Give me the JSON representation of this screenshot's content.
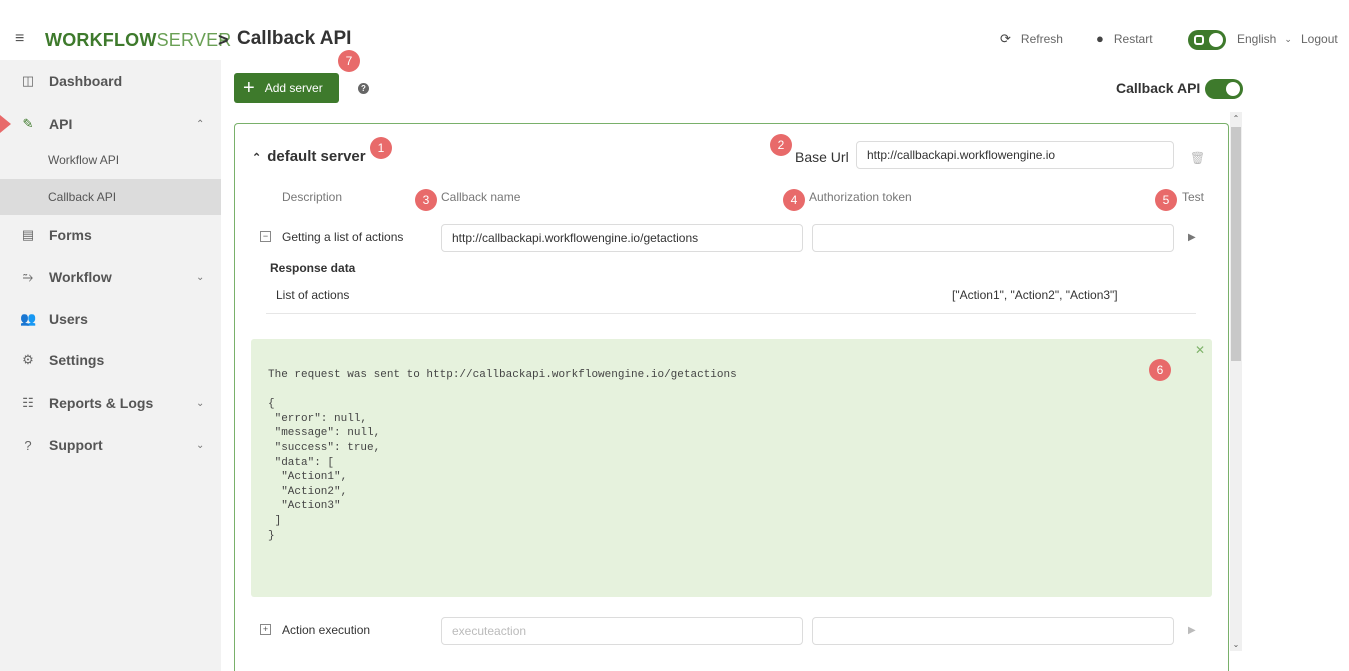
{
  "header": {
    "menu_icon": "menu-icon",
    "logo_part1": "WORKFLOW",
    "logo_part2": "SERVER",
    "separator": ">",
    "page_title": "Callback API",
    "refresh_label": "Refresh",
    "restart_label": "Restart",
    "language": "English",
    "logout_label": "Logout"
  },
  "sidebar": {
    "items": [
      {
        "label": "Dashboard",
        "icon": "dashboard-icon"
      },
      {
        "label": "API",
        "icon": "plug-icon",
        "expanded": true
      },
      {
        "label": "Workflow API"
      },
      {
        "label": "Callback API",
        "active": true
      },
      {
        "label": "Forms",
        "icon": "forms-icon"
      },
      {
        "label": "Workflow",
        "icon": "workflow-icon",
        "has_children": true
      },
      {
        "label": "Users",
        "icon": "users-icon"
      },
      {
        "label": "Settings",
        "icon": "settings-icon"
      },
      {
        "label": "Reports & Logs",
        "icon": "reports-icon",
        "has_children": true
      },
      {
        "label": "Support",
        "icon": "support-icon",
        "has_children": true
      }
    ]
  },
  "toolbar": {
    "add_server_label": "Add server",
    "help_glyph": "?",
    "callback_api_label": "Callback API",
    "callback_api_enabled": true
  },
  "server": {
    "title": "default server",
    "base_url_label": "Base Url",
    "base_url_value": "http://callbackapi.workflowengine.io",
    "columns": {
      "description": "Description",
      "callback_name": "Callback name",
      "auth_token": "Authorization token",
      "test": "Test"
    },
    "rows": [
      {
        "description": "Getting a list of actions",
        "callback_value": "http://callbackapi.workflowengine.io/getactions",
        "auth_value": "",
        "expanded": true
      },
      {
        "description": "Action execution",
        "callback_placeholder": "executeaction",
        "auth_value": "",
        "expanded": false
      }
    ],
    "response": {
      "title": "Response data",
      "name": "List of actions",
      "value": "[\"Action1\", \"Action2\", \"Action3\"]"
    },
    "console_text": "The request was sent to http://callbackapi.workflowengine.io/getactions\n\n{\n \"error\": null,\n \"message\": null,\n \"success\": true,\n \"data\": [\n  \"Action1\",\n  \"Action2\",\n  \"Action3\"\n ]\n}"
  },
  "annotations": [
    "1",
    "2",
    "3",
    "4",
    "5",
    "6",
    "7"
  ],
  "colors": {
    "brand_green": "#3e7a2c",
    "annotation_red": "#e86a6a",
    "console_bg": "#e6f2dd"
  }
}
